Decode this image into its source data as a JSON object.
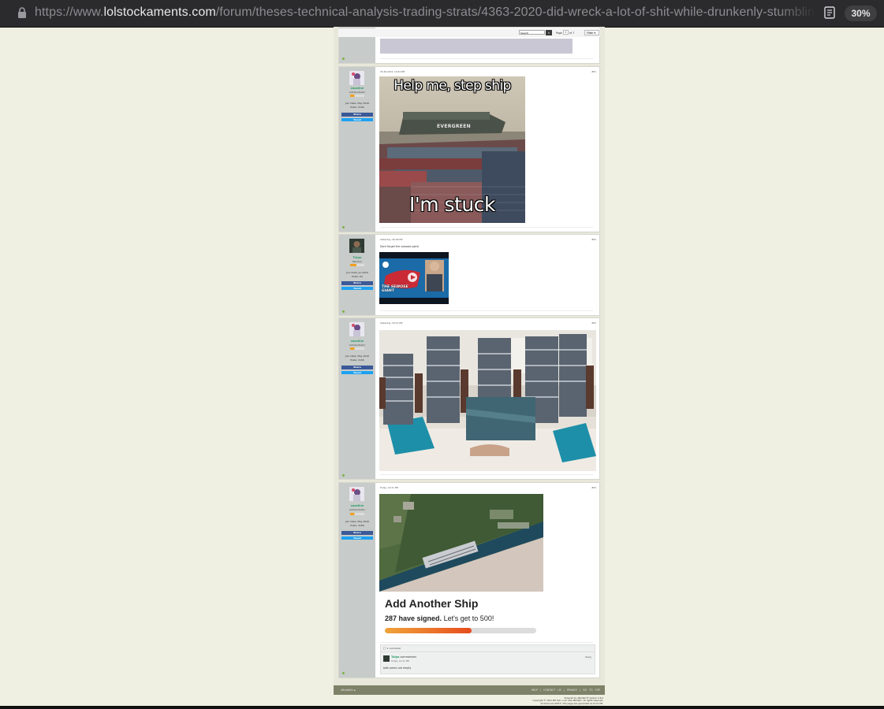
{
  "browser": {
    "url_prefix": "https://www.",
    "url_domain": "lolstockaments.com",
    "url_path": "/forum/theses-technical-analysis-trading-strats/4363-2020-did-wreck-a-lot-of-shit-while-drunkenly-stumbling-around-playing-w",
    "zoom": "30%"
  },
  "toolbar": {
    "search_placeholder": "Search",
    "page_label": "Page",
    "page_value": "7",
    "page_of": "of 7",
    "filter_label": "Filter"
  },
  "posts": [
    {
      "date": "03-26-2021, 10:44 PM",
      "number": "#61",
      "author": "zazaline",
      "role": "Administrator",
      "join": "Join Date: May 2020",
      "posts": "Posts: 2166",
      "share": "Share",
      "tweet": "Tweet",
      "meme_top": "Help me, step ship",
      "meme_ship": "EVERGREEN",
      "meme_bottom": "I'm stuck"
    },
    {
      "date": "Yesterday, 06:09 PM",
      "number": "#62",
      "author": "Tulgo",
      "role": "Member",
      "join": "Join Date: Jul 2020",
      "posts": "Posts: 64",
      "share": "Share",
      "tweet": "Tweet",
      "text": "Dont forget the swoosie giant",
      "video_caption": "THE SEWOSE GIANT"
    },
    {
      "date": "Yesterday, 09:12 PM",
      "number": "#63",
      "author": "zazaline",
      "role": "Administrator",
      "join": "Join Date: May 2020",
      "posts": "Posts: 2166",
      "share": "Share",
      "tweet": "Tweet"
    },
    {
      "date": "Today, 12:21 PM",
      "number": "#64",
      "author": "zazaline",
      "role": "Administrator",
      "join": "Join Date: May 2020",
      "posts": "Posts: 2166",
      "share": "Share",
      "tweet": "Tweet",
      "petition_title": "Add Another Ship",
      "petition_signed": "287 have signed.",
      "petition_goal": "Let's get to 500!",
      "petition_progress": 0.574,
      "comments_label": "1 comment",
      "comment_author": "Tulgo",
      "comment_verb": "commented",
      "comment_date": "Today, 12:21 PM",
      "comment_reply": "Reply",
      "comment_text": "both peens are empty"
    }
  ],
  "footer": {
    "left": "vBulletin ▴",
    "links": "HELP  |  CONTACT US  |  PRIVACY  |  GO TO TOP",
    "powered1": "Powered by vBulletin® Version 5.6.4",
    "powered2": "Copyright © 2021 MH Sub I, LLC dba vBulletin. All rights reserved.",
    "powered3": "All times are GMT-5. This page was generated at 12:21 PM."
  },
  "colors": {
    "page_bg": "#f0f0e2",
    "username": "#2a9d6a",
    "footer": "#7e8269",
    "share": "#3b5998",
    "tweet": "#1da1f2",
    "progress": "#e84c1f"
  }
}
